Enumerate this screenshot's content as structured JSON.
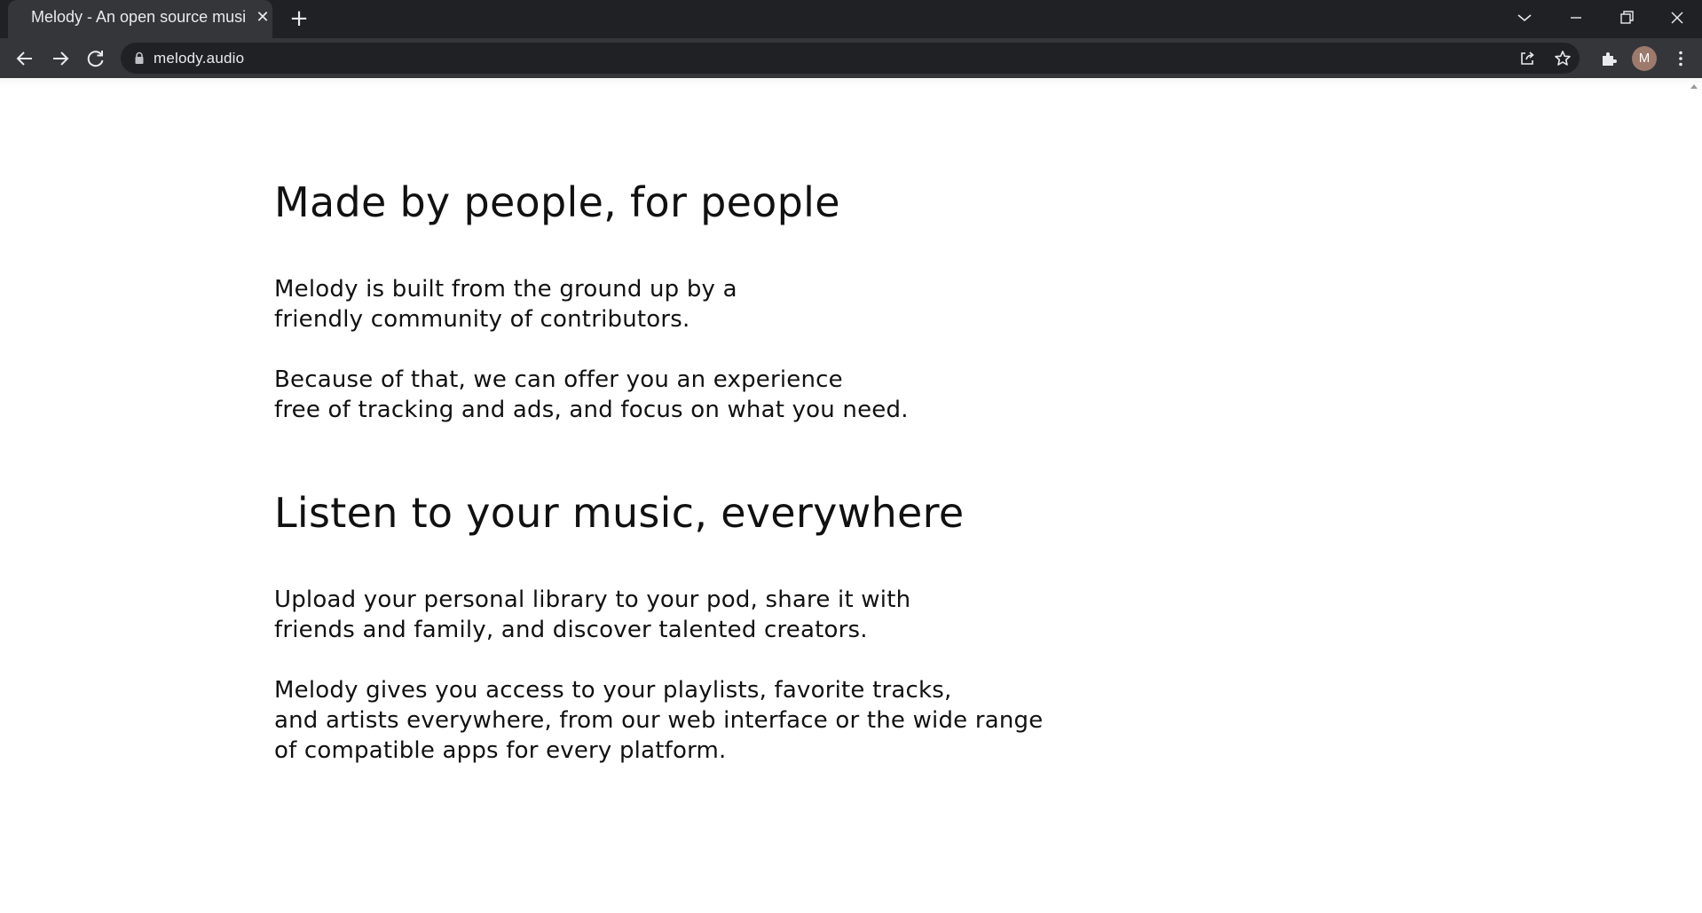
{
  "browser": {
    "tab_title": "Melody - An open source musi",
    "url": "melody.audio",
    "profile_initial": "M"
  },
  "sections": [
    {
      "title": "Made by people, for people",
      "paragraphs": [
        "Melody is built from the ground up by a\nfriendly community of contributors.",
        "Because of that, we can offer you an experience\nfree of tracking and ads, and focus on what you need."
      ]
    },
    {
      "title": "Listen to your music, everywhere",
      "paragraphs": [
        "Upload your personal library to your pod, share it with\nfriends and family, and discover talented creators.",
        "Melody gives you access to your playlists, favorite tracks,\nand artists everywhere, from our web interface or the wide range\nof compatible apps for every platform."
      ]
    }
  ]
}
